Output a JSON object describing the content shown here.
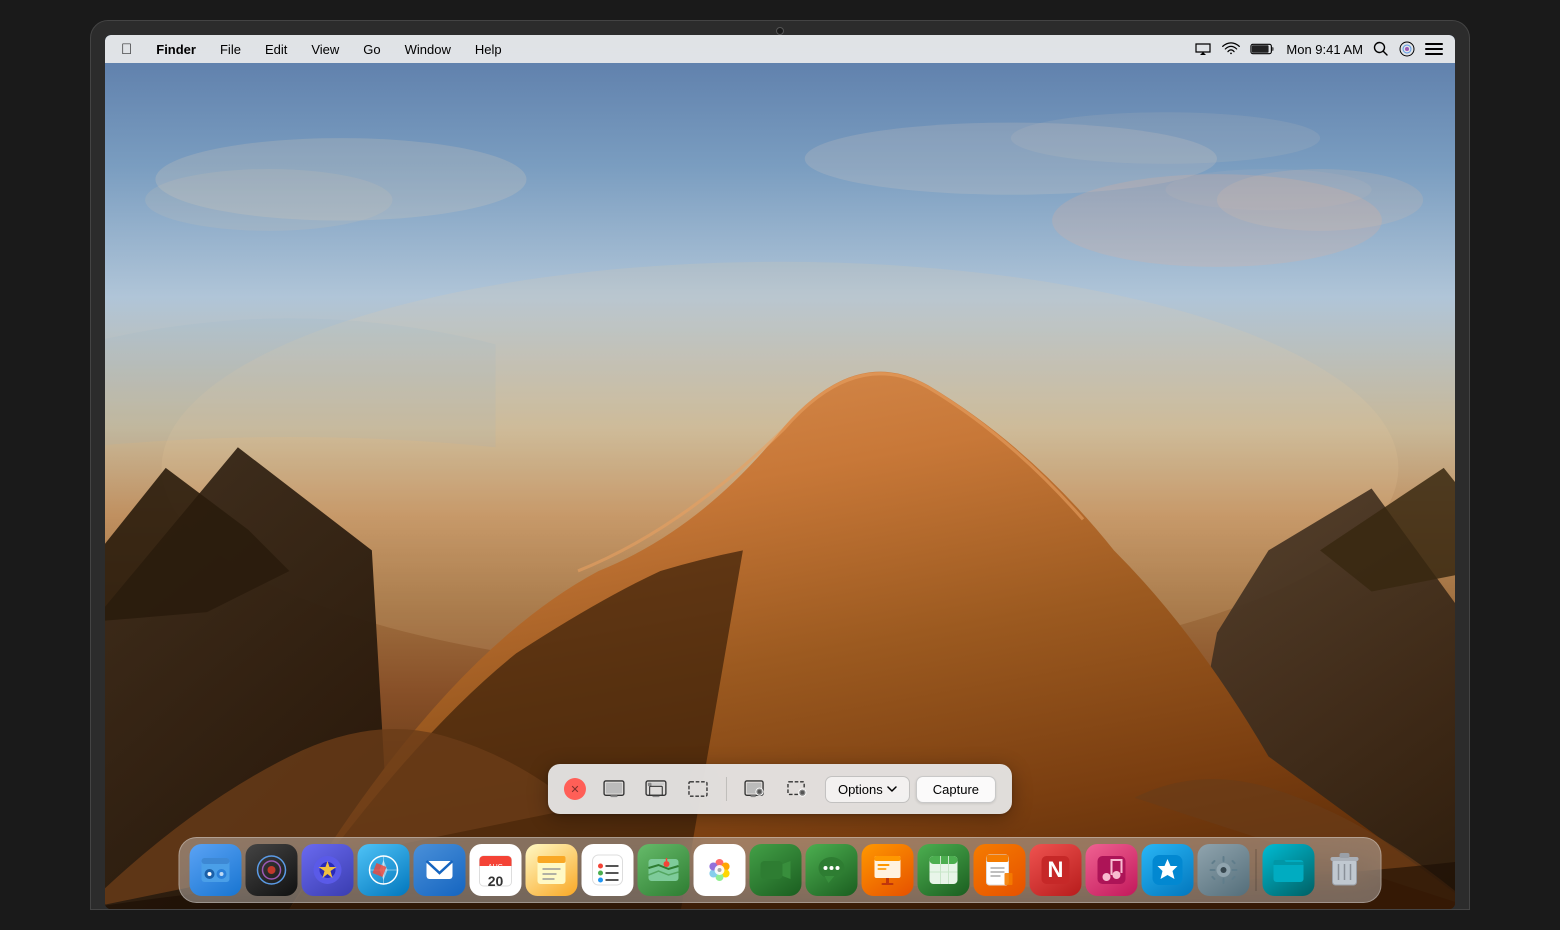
{
  "menubar": {
    "apple_label": "",
    "finder_label": "Finder",
    "file_label": "File",
    "edit_label": "Edit",
    "view_label": "View",
    "go_label": "Go",
    "window_label": "Window",
    "help_label": "Help",
    "time": "Mon 9:41 AM",
    "battery_icon": "battery-icon",
    "wifi_icon": "wifi-icon",
    "airplay_icon": "airplay-icon",
    "search_icon": "search-icon",
    "siri_icon": "siri-icon",
    "controlcenter_icon": "controlcenter-icon"
  },
  "screenshot_toolbar": {
    "close_label": "✕",
    "capture_entire_screen_label": "Capture Entire Screen",
    "capture_selected_window_label": "Capture Selected Window",
    "capture_selection_label": "Capture Selection",
    "record_entire_screen_label": "Record Entire Screen",
    "record_selection_label": "Record Selection",
    "options_label": "Options",
    "capture_label": "Capture"
  },
  "dock": {
    "items": [
      {
        "name": "finder",
        "label": "Finder",
        "emoji": "🖥"
      },
      {
        "name": "siri",
        "label": "Siri",
        "emoji": "🎙"
      },
      {
        "name": "launchpad",
        "label": "Launchpad",
        "emoji": "🚀"
      },
      {
        "name": "safari",
        "label": "Safari",
        "emoji": "🧭"
      },
      {
        "name": "mail",
        "label": "Mail",
        "emoji": "✉"
      },
      {
        "name": "notes",
        "label": "Notes",
        "emoji": "📝"
      },
      {
        "name": "reminders",
        "label": "Reminders",
        "emoji": "📋"
      },
      {
        "name": "maps",
        "label": "Maps",
        "emoji": "🗺"
      },
      {
        "name": "photos",
        "label": "Photos",
        "emoji": "🌸"
      },
      {
        "name": "facetime",
        "label": "FaceTime",
        "emoji": "📹"
      },
      {
        "name": "messages",
        "label": "Messages",
        "emoji": "💬"
      },
      {
        "name": "keynote",
        "label": "Keynote",
        "emoji": "📊"
      },
      {
        "name": "numbers",
        "label": "Numbers",
        "emoji": "🔢"
      },
      {
        "name": "pages",
        "label": "Pages",
        "emoji": "📄"
      },
      {
        "name": "news",
        "label": "News",
        "emoji": "📰"
      },
      {
        "name": "music",
        "label": "Music",
        "emoji": "🎵"
      },
      {
        "name": "appstore",
        "label": "App Store",
        "emoji": "🅰"
      },
      {
        "name": "prefs",
        "label": "System Preferences",
        "emoji": "⚙"
      },
      {
        "name": "finder2",
        "label": "Finder",
        "emoji": "📁"
      },
      {
        "name": "trash",
        "label": "Trash",
        "emoji": "🗑"
      }
    ]
  }
}
